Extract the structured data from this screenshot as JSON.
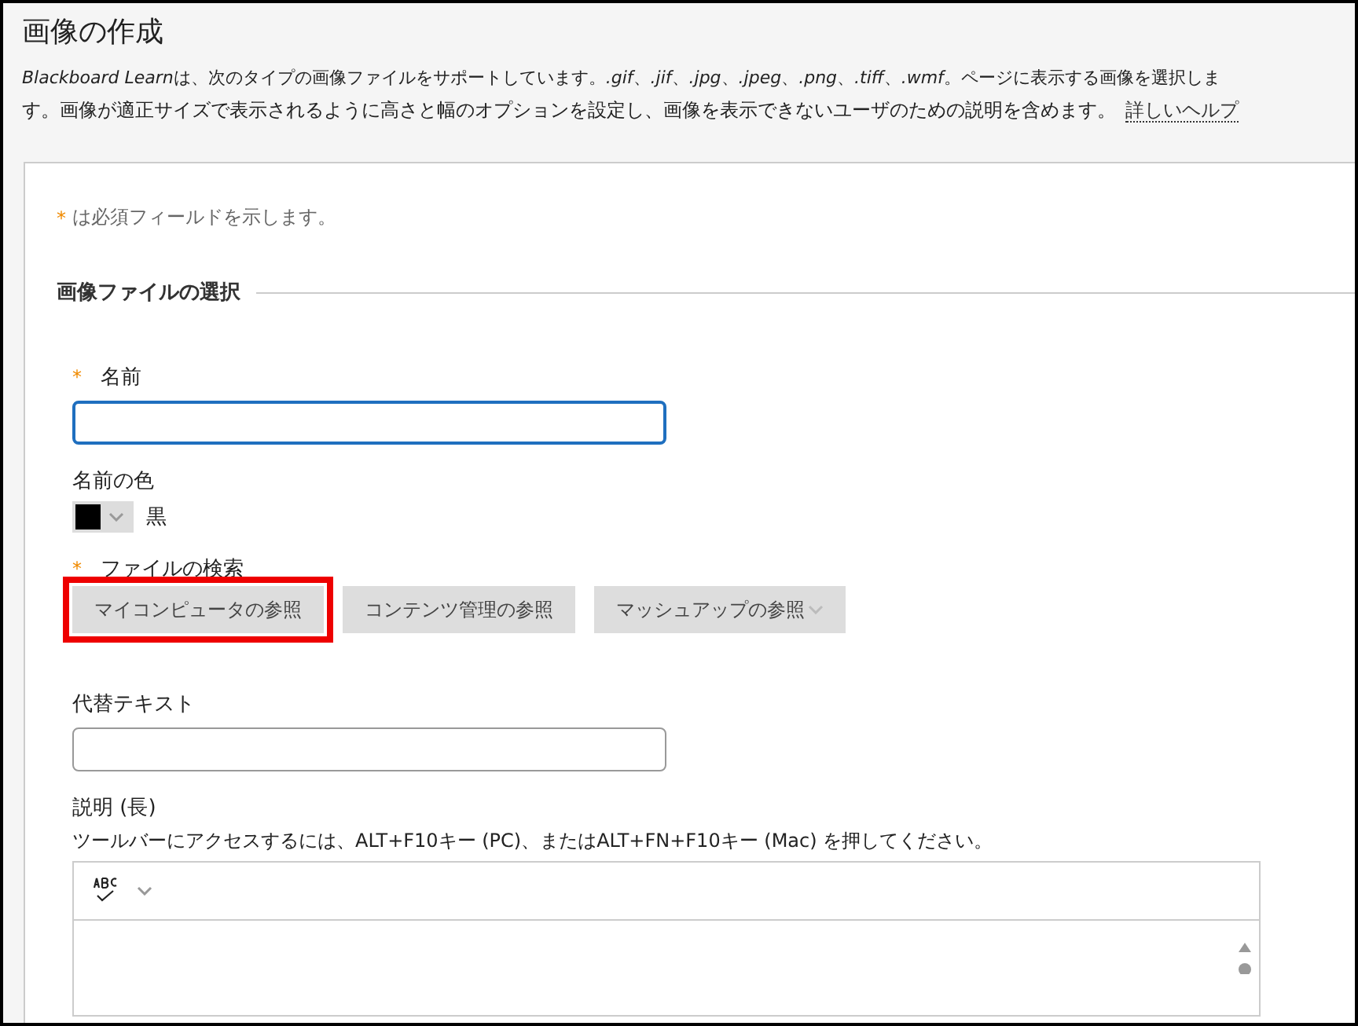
{
  "header": {
    "title": "画像の作成",
    "product_name": "Blackboard Learn",
    "description": "は、次のタイプの画像ファイルをサポートしています。*.gif*、*.jif*、*.jpg*、*.jpeg*、*.png*、*.tiff*、*.wmf*。ページに表示する画像を選択しま",
    "description_line2": "す。画像が適正サイズで表示されるように高さと幅のオプションを設定し、画像を表示できないユーザのための説明を含めます。",
    "help_link": "詳しいヘルプ"
  },
  "required_note": {
    "mark": "*",
    "text": "は必須フィールドを示します。"
  },
  "section": {
    "title": "画像ファイルの選択"
  },
  "name_field": {
    "mark": "*",
    "label": "名前",
    "focused": true
  },
  "name_color": {
    "label": "名前の色",
    "value": "黒"
  },
  "file_search": {
    "mark": "*",
    "label": "ファイルの検索",
    "buttons": [
      {
        "label": "マイコンピュータの参照",
        "highlighted": true,
        "has_menu": false
      },
      {
        "label": "コンテンツ管理の参照",
        "highlighted": false,
        "has_menu": false
      },
      {
        "label": "マッシュアップの参照",
        "highlighted": false,
        "has_menu": true
      }
    ]
  },
  "alt_text": {
    "label": "代替テキスト",
    "focused": false
  },
  "description_field": {
    "label": "説明 (長)",
    "hint": "ツールバーにアクセスするには、ALT+F10キー (PC)、またはALT+FN+F10キー (Mac) を押してください。"
  }
}
